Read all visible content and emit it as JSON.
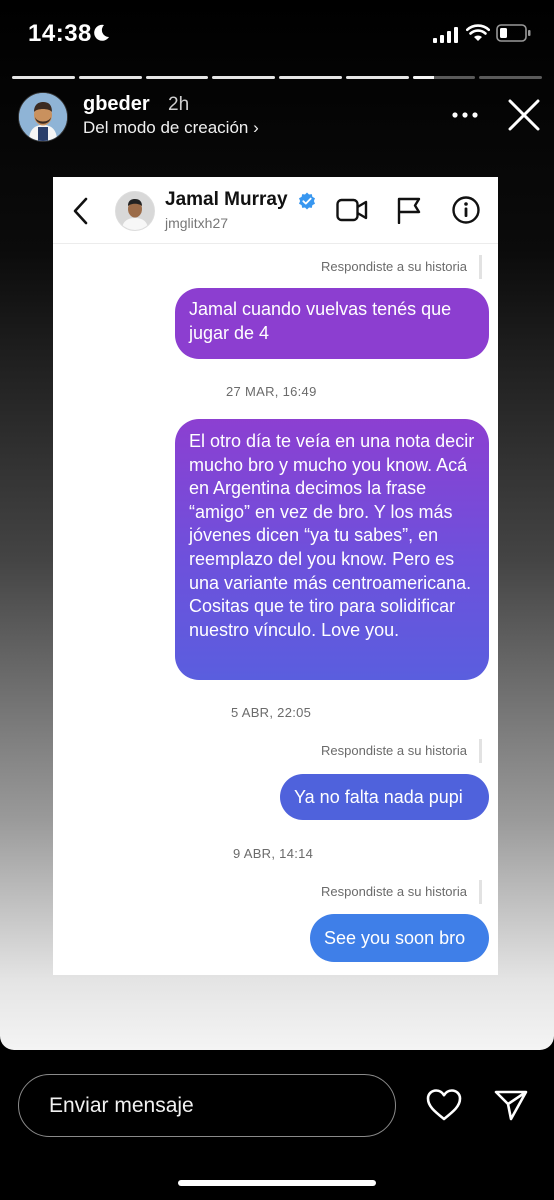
{
  "status_bar": {
    "time": "14:38"
  },
  "story": {
    "progress_segments": 8,
    "completed_segments": 6,
    "current_segment_progress": 0.35,
    "username": "gbeder",
    "time_ago": "2h",
    "subtitle": "Del modo de creación ›"
  },
  "dm": {
    "profile_name": "Jamal Murray",
    "handle": "jmglitxh27",
    "messages": [
      {
        "note": "Respondiste a su historia",
        "text": "Jamal cuando vuelvas tenés que jugar de 4"
      },
      {
        "timestamp": "27 MAR, 16:49",
        "text": "El otro día te veía en una nota decir mucho bro y mucho you know. Acá en Argentina decimos la frase “amigo” en vez de bro. Y los más jóvenes dicen “ya tu sabes”, en reemplazo del you know. Pero es una variante más centroamericana. Cositas que te tiro para solidificar nuestro vínculo. Love you."
      },
      {
        "timestamp": "5 ABR, 22:05",
        "note": "Respondiste a su historia",
        "text": "Ya no falta nada pupi"
      },
      {
        "timestamp": "9 ABR, 14:14",
        "note": "Respondiste a su historia",
        "text": "See you soon bro"
      }
    ]
  },
  "bottom_bar": {
    "placeholder": "Enviar mensaje"
  },
  "colors": {
    "verified": "#3897f0",
    "bubble_purple": "#8c3ed0",
    "bubble_blue": "#3f7fe8"
  }
}
